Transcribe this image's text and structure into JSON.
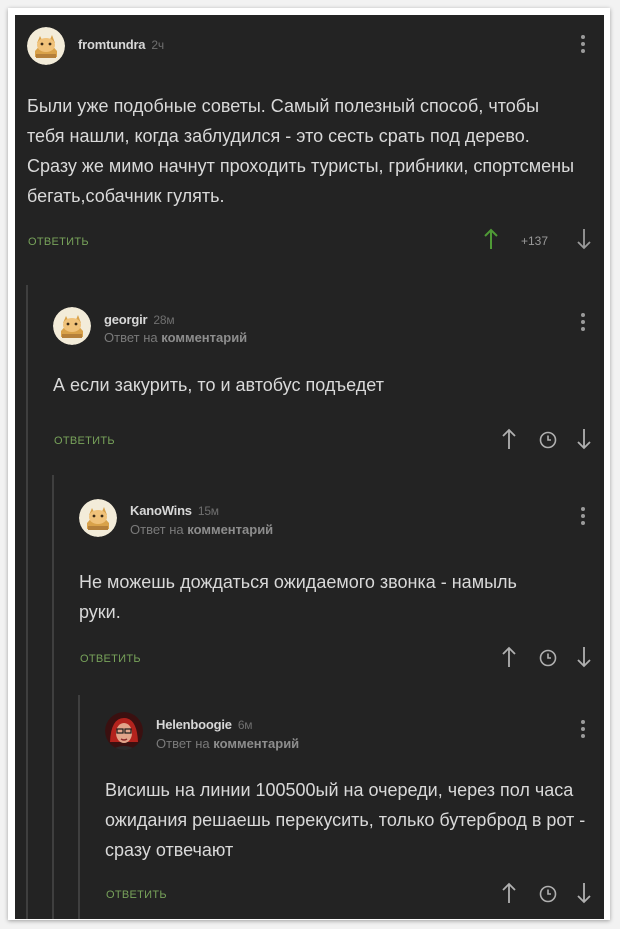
{
  "comments": [
    {
      "username": "fromtundra",
      "time": "2ч",
      "text": "Были уже подобные советы. Самый полезный способ, чтобы тебя нашли, когда заблудился - это сесть срать под дерево. Сразу же мимо начнут проходить туристы, грибники, спортсмены бегать,собачник гулять.",
      "reply_label": "ОТВЕТИТЬ",
      "rating": "+137",
      "avatar_icon": "pikabu-cat-avatar-icon"
    },
    {
      "username": "georgir",
      "time": "28м",
      "reply_prefix": "Ответ на",
      "reply_target": "комментарий",
      "text": "А если закурить, то и автобус подъедет",
      "reply_label": "ОТВЕТИТЬ",
      "avatar_icon": "pikabu-cat-avatar-icon"
    },
    {
      "username": "KanoWins",
      "time": "15м",
      "reply_prefix": "Ответ на",
      "reply_target": "комментарий",
      "text": "Не можешь дождаться ожидаемого звонка - намыль руки.",
      "reply_label": "ОТВЕТИТЬ",
      "avatar_icon": "pikabu-cat-avatar-icon"
    },
    {
      "username": "Helenboogie",
      "time": "6м",
      "reply_prefix": "Ответ на",
      "reply_target": "комментарий",
      "text": "Висишь на линии 100500ый на очереди, через пол часа ожидания решаешь перекусить, только бутерброд в рот - сразу отвечают",
      "reply_label": "ОТВЕТИТЬ",
      "avatar_icon": "user-photo-avatar-icon"
    }
  ],
  "colors": {
    "background": "#232323",
    "text": "#d9d9d9",
    "reply_green": "#77a25a",
    "upvote_green": "#4f9a36",
    "thread_line": "#3f3f3f"
  }
}
